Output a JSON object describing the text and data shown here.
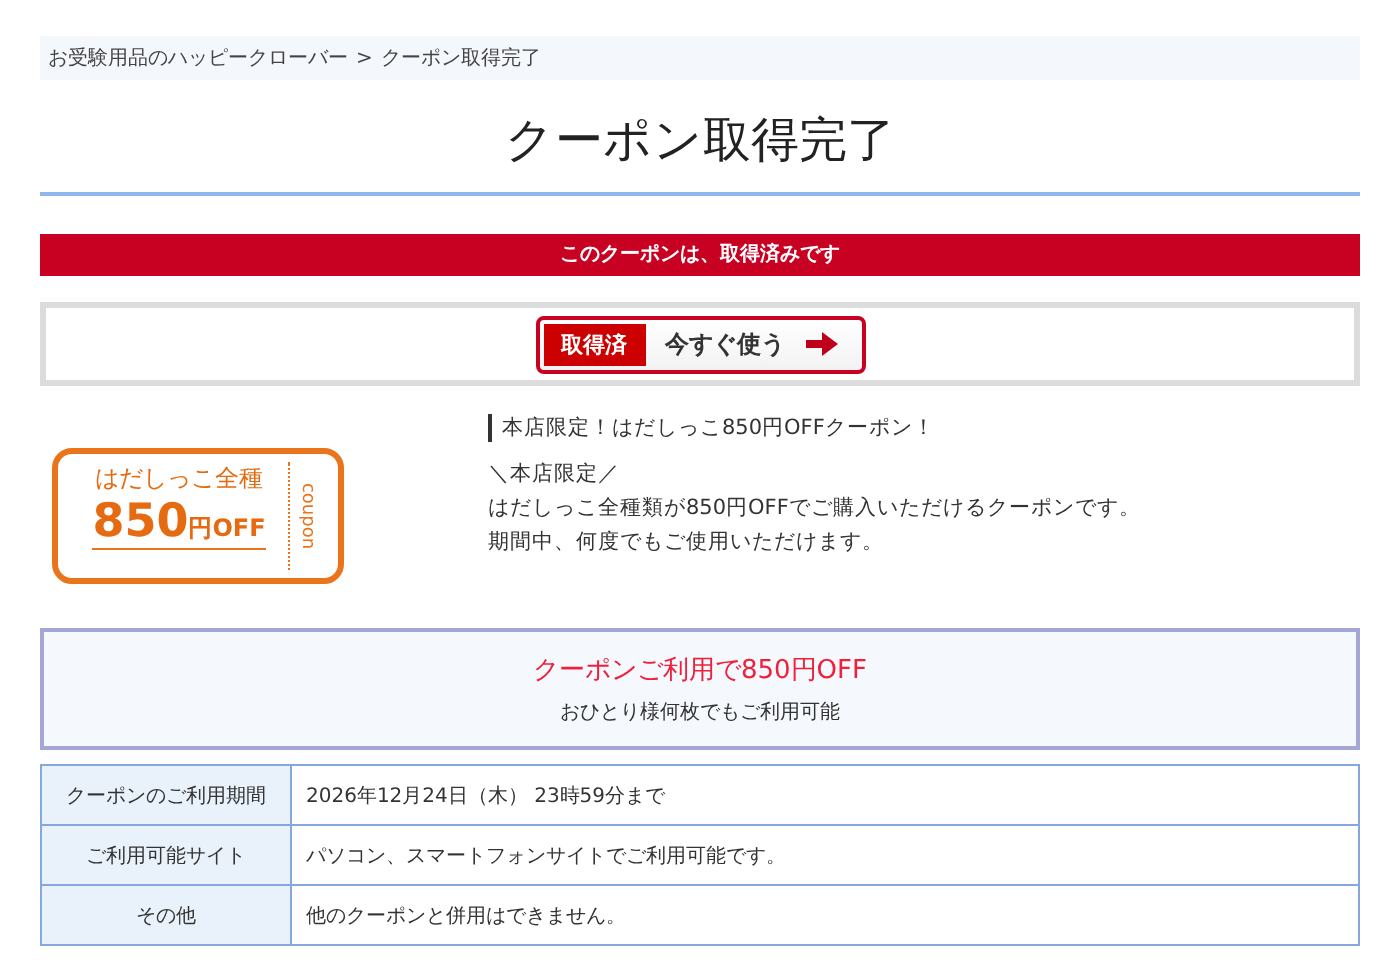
{
  "breadcrumb": [
    {
      "label": "お受験用品のハッピークローバー"
    },
    {
      "label": "クーポン取得完了"
    }
  ],
  "breadcrumb_separator": ">",
  "title": "クーポン取得完了",
  "notice": "このクーポンは、取得済みです",
  "action": {
    "status": "取得済",
    "label": "今すぐ使う"
  },
  "ticket": {
    "product": "はだしっこ全種",
    "amount": "850",
    "unit": "円OFF",
    "tag": "coupon"
  },
  "headline": "本店限定！はだしっこ850円OFFクーポン！",
  "description": [
    "＼本店限定／",
    "はだしっこ全種類が850円OFFでご購入いただけるクーポンです。",
    "期間中、何度でもご使用いただけます。"
  ],
  "summary": {
    "highlight": "クーポンご利用で850円OFF",
    "note": "おひとり様何枚でもご利用可能"
  },
  "details": [
    {
      "label": "クーポンのご利用期間",
      "value": "2026年12月24日（木） 23時59分まで"
    },
    {
      "label": "ご利用可能サイト",
      "value": "パソコン、スマートフォンサイトでご利用可能です。"
    },
    {
      "label": "その他",
      "value": "他のクーポンと併用はできません。"
    }
  ]
}
